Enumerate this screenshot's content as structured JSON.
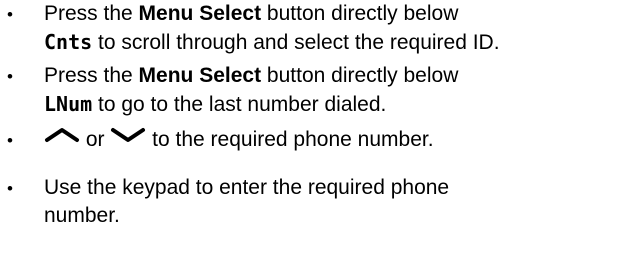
{
  "steps": [
    {
      "bullet": "•",
      "pre": "Press the ",
      "bold": "Menu Select",
      "mid": " button directly below",
      "softkey": "Cnts",
      "post": " to scroll through and select the required ID."
    },
    {
      "bullet": "•",
      "pre": "Press the ",
      "bold": "Menu Select",
      "mid": " button directly below",
      "softkey": "LNum",
      "post": " to go to the last number dialed."
    },
    {
      "bullet": "•",
      "up_icon": "chevron-up-icon",
      "connector": " or ",
      "down_icon": "chevron-down-icon",
      "post": " to the required phone number."
    },
    {
      "bullet": "•",
      "line1": "Use the keypad to enter the required phone",
      "line2": "number."
    }
  ]
}
